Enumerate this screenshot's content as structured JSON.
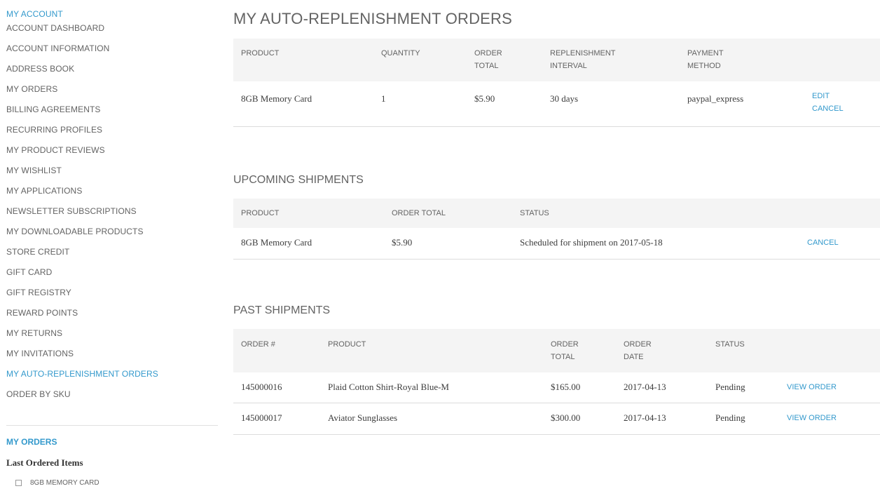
{
  "sidebar": {
    "title": "MY ACCOUNT",
    "items": [
      {
        "label": "ACCOUNT DASHBOARD"
      },
      {
        "label": "ACCOUNT INFORMATION"
      },
      {
        "label": "ADDRESS BOOK"
      },
      {
        "label": "MY ORDERS"
      },
      {
        "label": "BILLING AGREEMENTS"
      },
      {
        "label": "RECURRING PROFILES"
      },
      {
        "label": "MY PRODUCT REVIEWS"
      },
      {
        "label": "MY WISHLIST"
      },
      {
        "label": "MY APPLICATIONS"
      },
      {
        "label": "NEWSLETTER SUBSCRIPTIONS"
      },
      {
        "label": "MY DOWNLOADABLE PRODUCTS"
      },
      {
        "label": "STORE CREDIT"
      },
      {
        "label": "GIFT CARD"
      },
      {
        "label": "GIFT REGISTRY"
      },
      {
        "label": "REWARD POINTS"
      },
      {
        "label": "MY RETURNS"
      },
      {
        "label": "MY INVITATIONS"
      },
      {
        "label": "MY AUTO-REPLENISHMENT ORDERS"
      },
      {
        "label": "ORDER BY SKU"
      }
    ],
    "active_index": 17,
    "orders_title": "MY ORDERS",
    "last_ordered_title": "Last Ordered Items",
    "last_ordered_item": "8GB MEMORY CARD"
  },
  "main": {
    "page_title": "MY AUTO-REPLENISHMENT ORDERS",
    "orders_table": {
      "headers": [
        "PRODUCT",
        "QUANTITY",
        "ORDER TOTAL",
        "REPLENISHMENT INTERVAL",
        "PAYMENT METHOD"
      ],
      "header_lines": [
        [
          "PRODUCT"
        ],
        [
          "QUANTITY"
        ],
        [
          "ORDER",
          "TOTAL"
        ],
        [
          "REPLENISHMENT",
          "INTERVAL"
        ],
        [
          "PAYMENT",
          "METHOD"
        ]
      ],
      "rows": [
        {
          "product": "8GB Memory Card",
          "quantity": "1",
          "order_total": "$5.90",
          "interval": "30 days",
          "payment_method": "paypal_express",
          "edit": "EDIT",
          "cancel": "CANCEL"
        }
      ]
    },
    "upcoming": {
      "title": "UPCOMING SHIPMENTS",
      "headers": [
        "PRODUCT",
        "ORDER TOTAL",
        "STATUS"
      ],
      "rows": [
        {
          "product": "8GB Memory Card",
          "order_total": "$5.90",
          "status": "Scheduled for shipment on 2017-05-18",
          "cancel": "CANCEL"
        }
      ]
    },
    "past": {
      "title": "PAST SHIPMENTS",
      "headers": [
        "ORDER #",
        "PRODUCT",
        "ORDER TOTAL",
        "ORDER DATE",
        "STATUS"
      ],
      "header_lines": [
        [
          "ORDER #"
        ],
        [
          "PRODUCT"
        ],
        [
          "ORDER",
          "TOTAL"
        ],
        [
          "ORDER",
          "DATE"
        ],
        [
          "STATUS"
        ]
      ],
      "rows": [
        {
          "order_no": "145000016",
          "product": "Plaid Cotton Shirt-Royal Blue-M",
          "order_total": "$165.00",
          "order_date": "2017-04-13",
          "status": "Pending",
          "action": "VIEW ORDER"
        },
        {
          "order_no": "145000017",
          "product": "Aviator Sunglasses",
          "order_total": "$300.00",
          "order_date": "2017-04-13",
          "status": "Pending",
          "action": "VIEW ORDER"
        }
      ]
    }
  },
  "colors": {
    "accent": "#3399cc",
    "text": "#636363",
    "header_bg": "#f4f4f4",
    "divider": "#dcdcdc"
  }
}
